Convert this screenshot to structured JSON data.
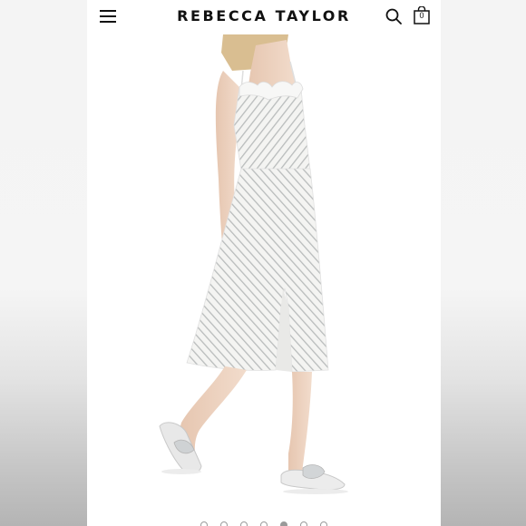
{
  "header": {
    "brand": "REBECCA TAYLOR",
    "bag_count": "0"
  },
  "icons": {
    "menu": "hamburger-menu-icon",
    "search": "search-icon",
    "bag": "shopping-bag-icon"
  },
  "product_image": {
    "subject": "model wearing white striped midi slip dress with front slit and metallic knotted slide sandals"
  },
  "carousel": {
    "total": 7,
    "active_index": 4
  },
  "colors": {
    "background": "#ffffff",
    "text": "#111111",
    "dress": "#f4f4f2",
    "stripe": "#b9bcbc",
    "skin": "#eed5c3",
    "hair": "#d6b98a"
  }
}
